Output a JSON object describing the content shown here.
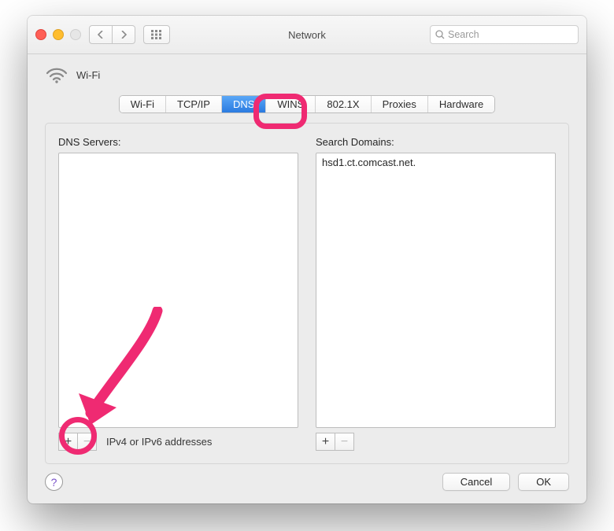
{
  "window": {
    "title": "Network",
    "interface_name": "Wi-Fi"
  },
  "search": {
    "placeholder": "Search"
  },
  "tabs": [
    {
      "label": "Wi-Fi",
      "active": false
    },
    {
      "label": "TCP/IP",
      "active": false
    },
    {
      "label": "DNS",
      "active": true
    },
    {
      "label": "WINS",
      "active": false
    },
    {
      "label": "802.1X",
      "active": false
    },
    {
      "label": "Proxies",
      "active": false
    },
    {
      "label": "Hardware",
      "active": false
    }
  ],
  "dns": {
    "servers_heading": "DNS Servers:",
    "servers": [],
    "servers_hint": "IPv4 or IPv6 addresses",
    "domains_heading": "Search Domains:",
    "domains": [
      "hsd1.ct.comcast.net."
    ]
  },
  "buttons": {
    "cancel": "Cancel",
    "ok": "OK"
  }
}
